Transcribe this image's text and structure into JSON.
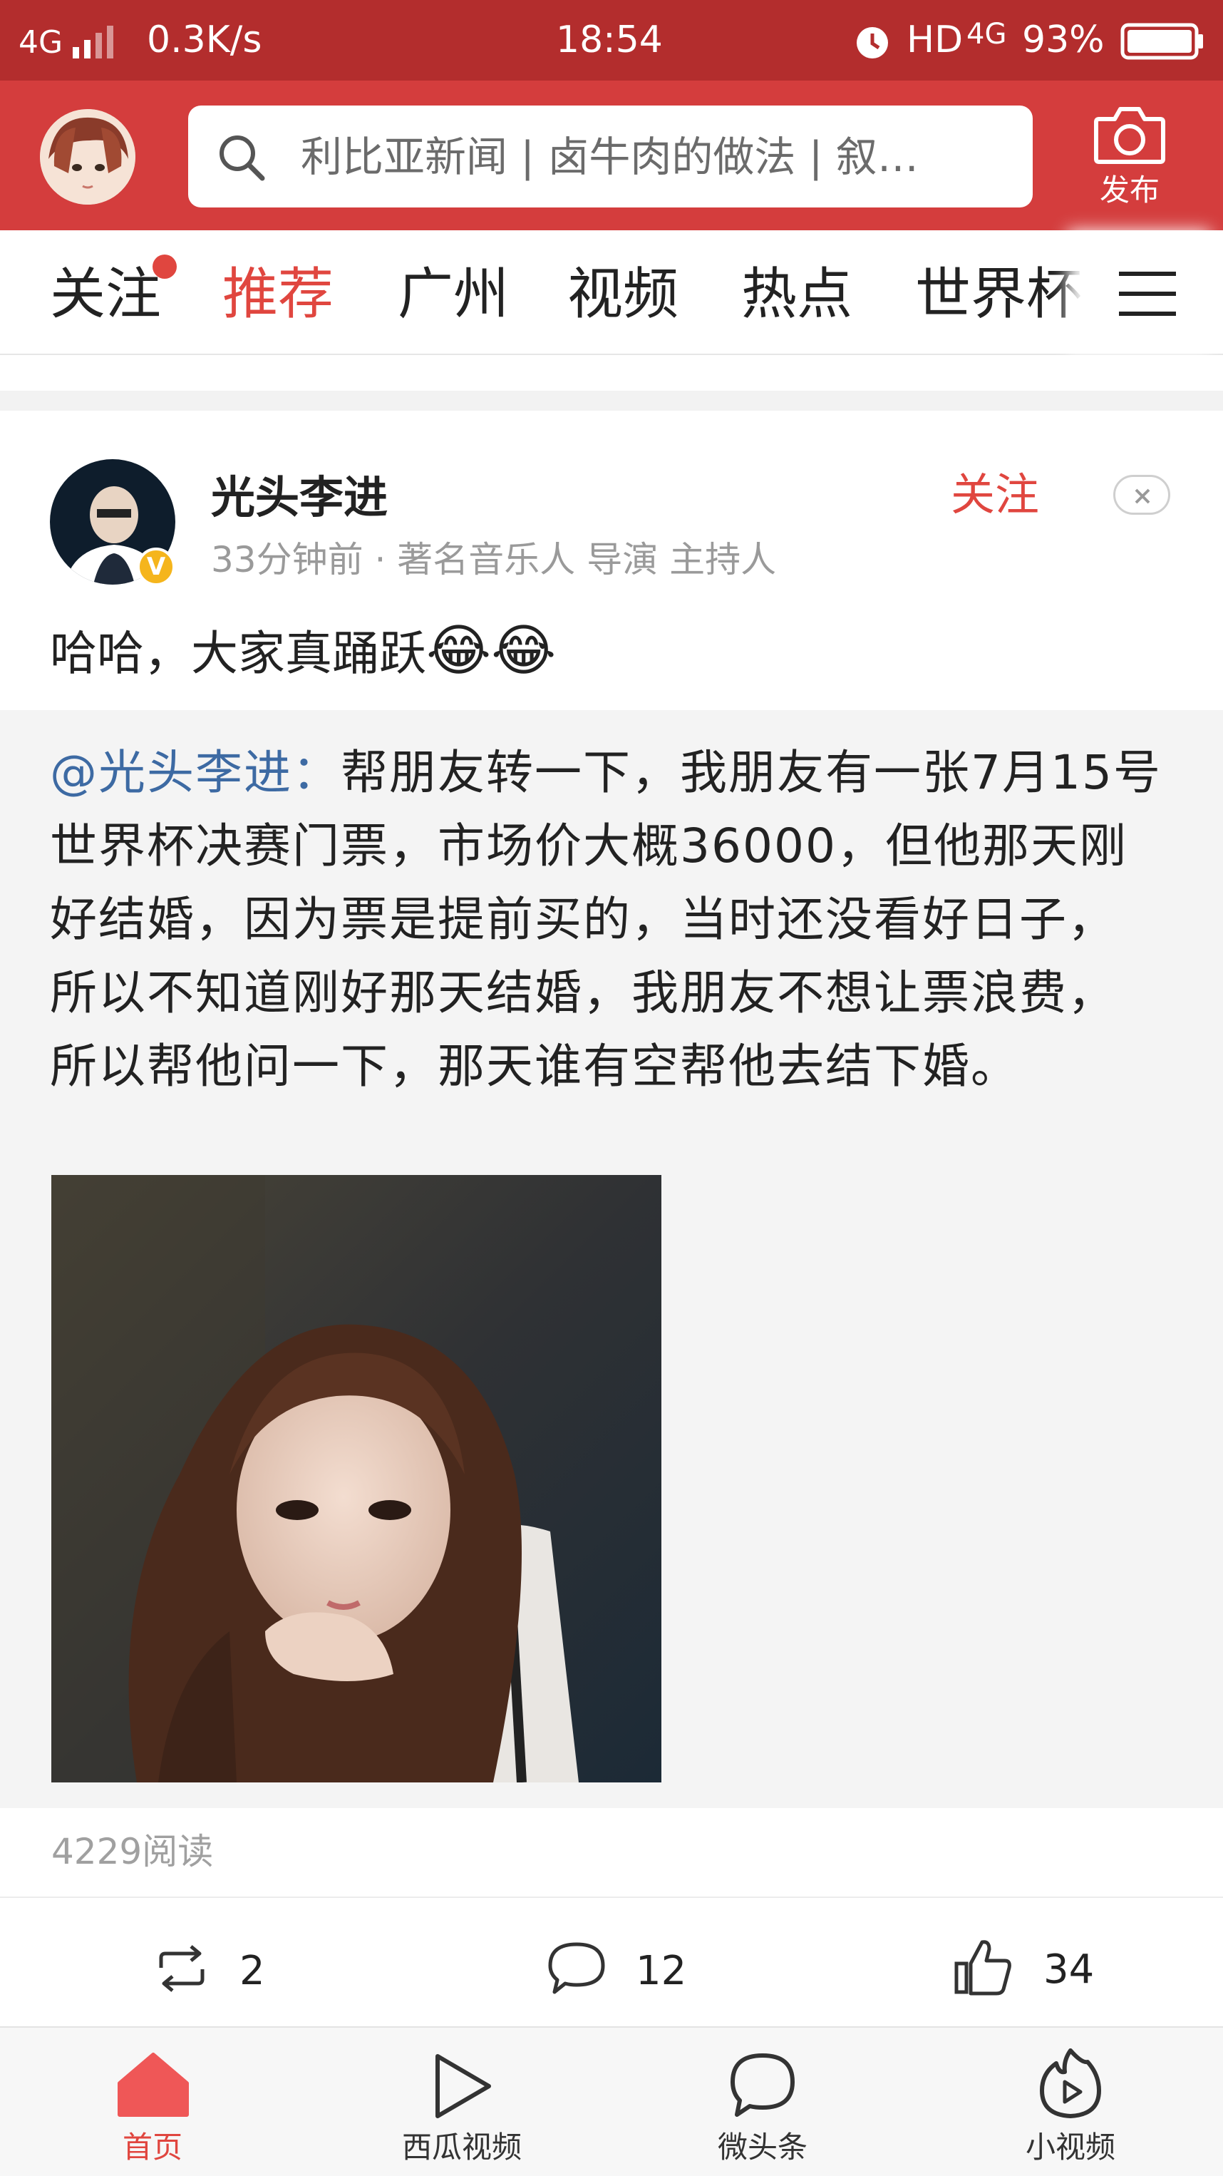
{
  "status_bar": {
    "network": "4G",
    "speed": "0.3K/s",
    "time": "18:54",
    "hd": "HD",
    "network_right": "4G",
    "battery": "93%"
  },
  "header": {
    "search_placeholder": "利比亚新闻 | 卤牛肉的做法 | 叙…",
    "publish_label": "发布"
  },
  "tabs": [
    {
      "label": "关注"
    },
    {
      "label": "推荐"
    },
    {
      "label": "广州"
    },
    {
      "label": "视频"
    },
    {
      "label": "热点"
    },
    {
      "label": "世界杯"
    }
  ],
  "post": {
    "author": "光头李进",
    "meta": "33分钟前 · 著名音乐人 导演 主持人",
    "follow_label": "关注",
    "verified_badge": "V",
    "text": "哈哈，大家真踊跃",
    "emoji": "😂😂",
    "repost": {
      "mention": "@光头李进：",
      "text": "帮朋友转一下，我朋友有一张7月15号世界杯决赛门票，市场价大概36000，但他那天刚好结婚，因为票是提前买的，当时还没看好日子，所以不知道刚好那天结婚，我朋友不想让票浪费，所以帮他问一下，那天谁有空帮他去结下婚。"
    },
    "reads": "4229阅读",
    "actions": {
      "repost_count": "2",
      "comment_count": "12",
      "like_count": "34"
    }
  },
  "bottom_nav": [
    {
      "label": "首页",
      "icon": "home-icon"
    },
    {
      "label": "西瓜视频",
      "icon": "play-icon"
    },
    {
      "label": "微头条",
      "icon": "chat-icon"
    },
    {
      "label": "小视频",
      "icon": "flame-play-icon"
    }
  ],
  "colors": {
    "status_bar": "#b32d2d",
    "header": "#d43d3d",
    "accent": "#e0463f",
    "mention": "#3d6aa3"
  }
}
